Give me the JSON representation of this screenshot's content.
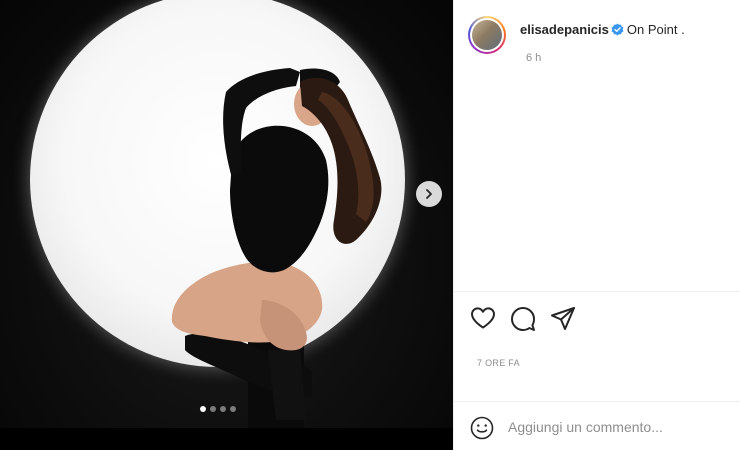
{
  "post": {
    "username": "elisadepanicis",
    "caption": "On Point .",
    "relative_time": "6 h",
    "date": "7 ORE FA"
  },
  "carousel": {
    "slide_count": 4,
    "active_index": 0
  },
  "comment": {
    "placeholder": "Aggiungi un commento..."
  },
  "icons": {
    "verified": "verified-badge-icon",
    "like": "heart-icon",
    "comment": "comment-bubble-icon",
    "share": "paper-plane-icon",
    "emoji": "smiley-icon",
    "next": "chevron-right-icon"
  },
  "colors": {
    "verified": "#3897f0",
    "text": "#262626",
    "muted": "#8e8e8e"
  }
}
